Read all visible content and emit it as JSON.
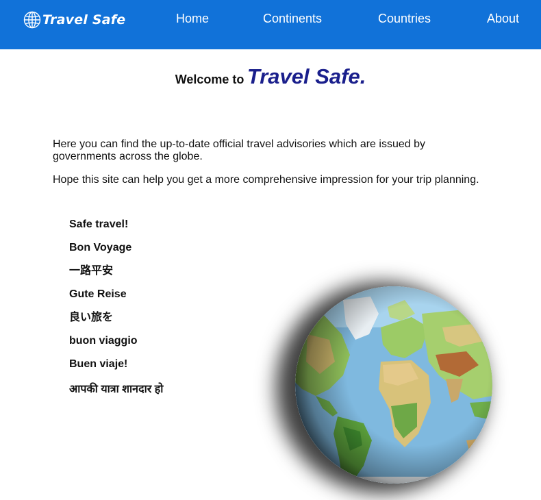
{
  "nav": {
    "brand": "Travel Safe",
    "brand_icon": "globe-icon",
    "links": [
      "Home",
      "Continents",
      "Countries",
      "About"
    ]
  },
  "welcome": {
    "prefix": "Welcome to",
    "brand": "Travel Safe."
  },
  "intro": {
    "p1": "Here you can find the up-to-date official travel advisories which are issued by governments across the globe.",
    "p2": "Hope this site can help you get a more comprehensive impression for your trip planning."
  },
  "greetings": [
    "Safe travel!",
    "Bon Voyage",
    "一路平安",
    "Gute Reise",
    "良い旅を",
    "buon viaggio",
    "Buen viaje!",
    "आपकी यात्रा शानदार हो"
  ],
  "colors": {
    "nav_background": "#1172d9",
    "brand_title": "#1a1f8c"
  }
}
